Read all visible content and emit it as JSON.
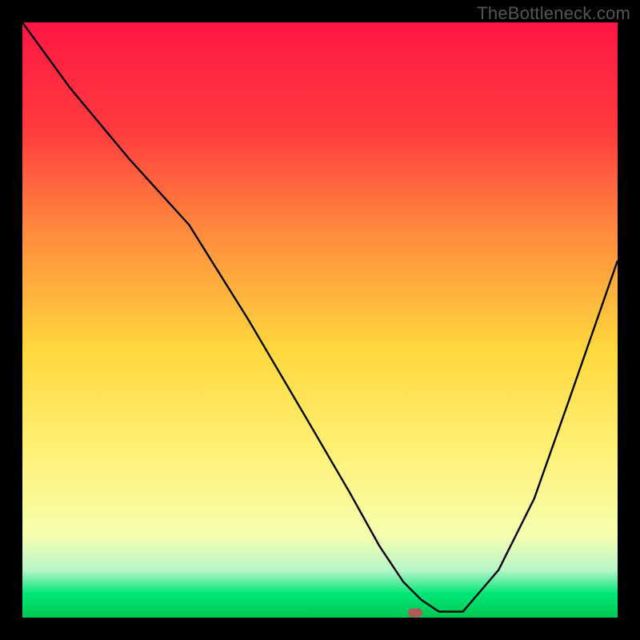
{
  "watermark": "TheBottleneck.com",
  "chart_data": {
    "type": "line",
    "title": "",
    "xlabel": "",
    "ylabel": "",
    "xlim": [
      0,
      100
    ],
    "ylim": [
      0,
      100
    ],
    "grid": false,
    "legend": false,
    "gradient_stops": [
      {
        "offset": 0,
        "color": "#ff1744"
      },
      {
        "offset": 18,
        "color": "#ff3b3e"
      },
      {
        "offset": 35,
        "color": "#ff8a3d"
      },
      {
        "offset": 55,
        "color": "#ffd83d"
      },
      {
        "offset": 72,
        "color": "#fff176"
      },
      {
        "offset": 86,
        "color": "#f7ffae"
      },
      {
        "offset": 92,
        "color": "#b9f6ca"
      },
      {
        "offset": 96,
        "color": "#00e676"
      },
      {
        "offset": 100,
        "color": "#00c853"
      }
    ],
    "x": [
      0,
      8,
      18,
      28,
      38,
      48,
      55,
      60,
      64,
      67,
      70,
      74,
      80,
      86,
      92,
      100
    ],
    "values": [
      100,
      89,
      77,
      66,
      50,
      33,
      21,
      12,
      6,
      3,
      1,
      1,
      8,
      20,
      37,
      60
    ],
    "marker": {
      "x": 66,
      "y": 0.8,
      "color": "#b05a5a"
    }
  }
}
